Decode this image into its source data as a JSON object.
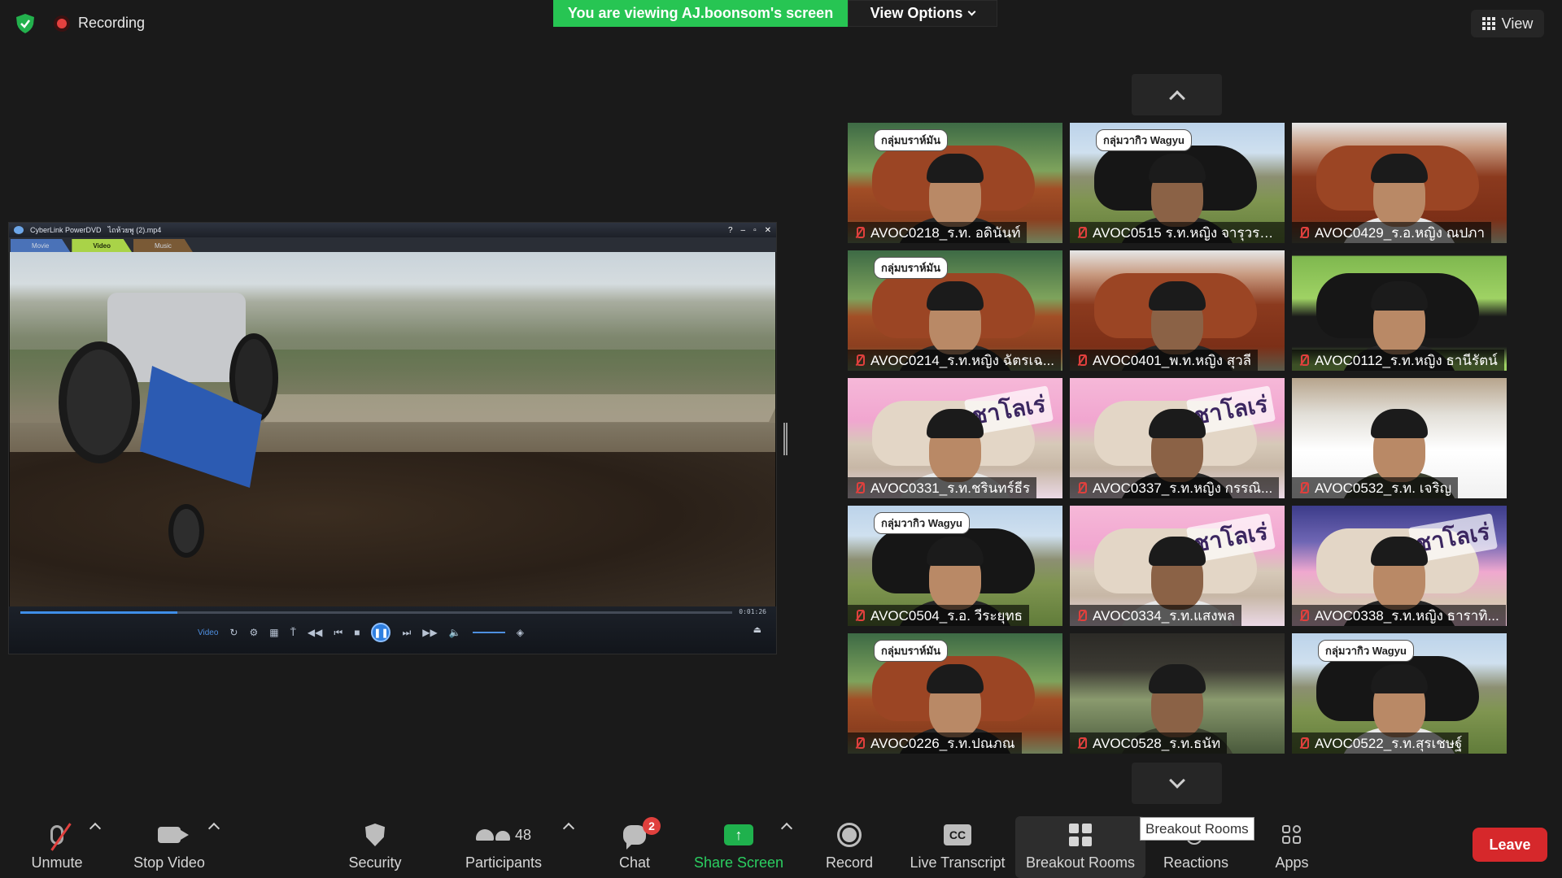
{
  "top_bar": {
    "recording_label": "Recording",
    "viewing_banner": "You are viewing AJ.boonsom's screen",
    "view_options_label": "View Options",
    "view_label": "View"
  },
  "shared_screen": {
    "app_title": "CyberLink PowerDVD",
    "file_name": "ไถห้วยพู (2).mp4",
    "tabs": [
      "Movie",
      "Video",
      "Music"
    ],
    "video_label": "Video",
    "time_display": "0:01:26",
    "progress_fraction": 0.22
  },
  "gallery": {
    "participants": [
      {
        "name": "AVOC0218_ร.ท. อดินันท์",
        "bg": "brahman",
        "sticker": "กลุ่มบราห์มัน",
        "brand": ""
      },
      {
        "name": "AVOC0515 ร.ท.หญิง จารุวรร...",
        "bg": "wagyu",
        "sticker": "กลุ่มวากิว Wagyu",
        "brand": ""
      },
      {
        "name": "AVOC0429_ร.อ.หญิง ณปภา",
        "bg": "redcow",
        "sticker": "",
        "brand": ""
      },
      {
        "name": "AVOC0214_ร.ท.หญิง ฉัตรเฉ...",
        "bg": "brahman",
        "sticker": "กลุ่มบราห์มัน",
        "brand": ""
      },
      {
        "name": "AVOC0401_พ.ท.หญิง สุวลี",
        "bg": "redcow",
        "sticker": "",
        "brand": ""
      },
      {
        "name": "AVOC0112_ร.ท.หญิง ธานีรัตน์",
        "bg": "blackcow",
        "sticker": "",
        "brand": ""
      },
      {
        "name": "AVOC0331_ร.ท.ชรินทร์ธีร",
        "bg": "charolais",
        "sticker": "",
        "brand": "ชาโลเร่"
      },
      {
        "name": "AVOC0337_ร.ท.หญิง กรรณิ...",
        "bg": "charolais",
        "sticker": "",
        "brand": "ชาโลเร่"
      },
      {
        "name": "AVOC0532_ร.ท. เจริญ",
        "bg": "office",
        "sticker": "",
        "brand": ""
      },
      {
        "name": "AVOC0504_ร.อ. วีระยุทธ",
        "bg": "wagyu",
        "sticker": "กลุ่มวากิว Wagyu",
        "brand": ""
      },
      {
        "name": "AVOC0334_ร.ท.แสงพล",
        "bg": "charolais",
        "sticker": "",
        "brand": "ชาโลเร่"
      },
      {
        "name": "AVOC0338_ร.ท.หญิง ธาราทิ...",
        "bg": "charolais-night",
        "sticker": "",
        "brand": "ชาโลเร่"
      },
      {
        "name": "AVOC0226_ร.ท.ปณภณ",
        "bg": "brahman",
        "sticker": "กลุ่มบราห์มัน",
        "brand": ""
      },
      {
        "name": "AVOC0528_ร.ท.ธนัท",
        "bg": "dark-studio",
        "sticker": "",
        "brand": ""
      },
      {
        "name": "AVOC0522_ร.ท.สุรเชษฐ์",
        "bg": "wagyu",
        "sticker": "กลุ่มวากิว Wagyu",
        "brand": ""
      }
    ]
  },
  "toolbar": {
    "unmute": "Unmute",
    "stop_video": "Stop Video",
    "security": "Security",
    "participants": "Participants",
    "participants_count": "48",
    "chat": "Chat",
    "chat_badge": "2",
    "share_screen": "Share Screen",
    "record": "Record",
    "live_transcript": "Live Transcript",
    "cc_icon_text": "CC",
    "breakout_rooms": "Breakout Rooms",
    "reactions": "Reactions",
    "apps": "Apps",
    "tooltip": "Breakout Rooms",
    "leave": "Leave"
  },
  "colors": {
    "banner_green": "#27c553",
    "share_green": "#2bcf61",
    "leave_red": "#d6282b",
    "mute_red": "#e0403d"
  },
  "icons": [
    "shield-check-icon",
    "recording-icon",
    "chevron-down-icon",
    "grid-view-icon",
    "mic-muted-icon",
    "camera-icon",
    "security-shield-icon",
    "participants-icon",
    "chat-icon",
    "share-screen-icon",
    "record-icon",
    "cc-icon",
    "breakout-rooms-icon",
    "reactions-icon",
    "apps-icon"
  ]
}
